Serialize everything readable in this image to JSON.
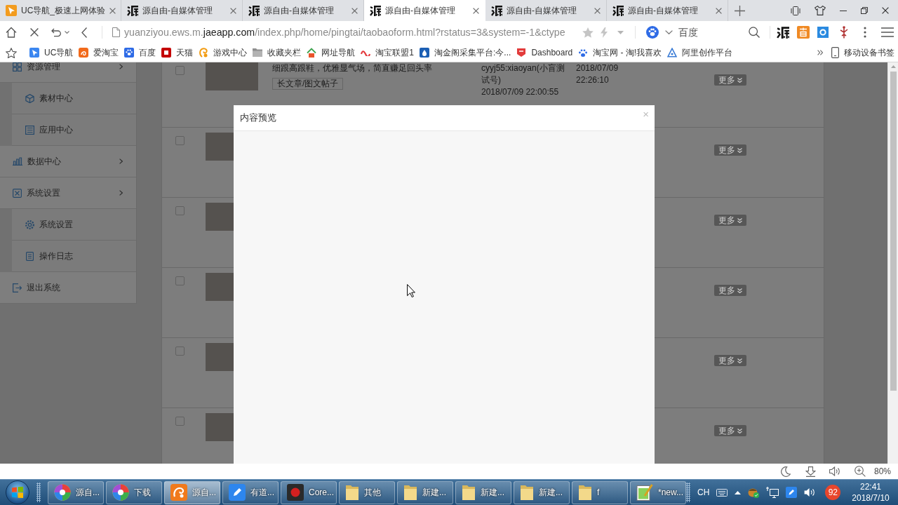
{
  "browser": {
    "tabs": [
      {
        "title": "UC导航_极速上网体验",
        "kind": "start",
        "selected": false
      },
      {
        "title": "源自由-自媒体管理",
        "kind": "site",
        "selected": false
      },
      {
        "title": "源自由-自媒体管理",
        "kind": "site",
        "selected": false
      },
      {
        "title": "源自由-自媒体管理",
        "kind": "site",
        "selected": true
      },
      {
        "title": "源自由-自媒体管理",
        "kind": "site",
        "selected": false
      },
      {
        "title": "源自由-自媒体管理",
        "kind": "site",
        "selected": false
      }
    ],
    "address_bar": {
      "url": "yuanziyou.ews.m.**jaeapp.com**/index.php/home/pingtai/taobaoform.html?rstatus=3&system=-1&ctype"
    },
    "search": {
      "placeholder": "百度"
    },
    "bookmarks": [
      {
        "label": "UC导航",
        "kind": "uc"
      },
      {
        "label": "爱淘宝",
        "kind": "taobao"
      },
      {
        "label": "百度",
        "kind": "baidu"
      },
      {
        "label": "天猫",
        "kind": "tmall"
      },
      {
        "label": "游戏中心",
        "kind": "games"
      },
      {
        "label": "收藏夹栏",
        "kind": "folder"
      },
      {
        "label": "网址导航",
        "kind": "sites"
      },
      {
        "label": "淘宝联盟1",
        "kind": "alliance"
      },
      {
        "label": "淘金阁采集平台:今...",
        "kind": "collector"
      },
      {
        "label": "Dashboard",
        "kind": "dashboard"
      },
      {
        "label": "淘宝网 - 淘!我喜欢",
        "kind": "taobaonet"
      },
      {
        "label": "阿里创作平台",
        "kind": "creator"
      }
    ],
    "mobile_bookmarks": {
      "label": "移动设备书签"
    }
  },
  "page": {
    "sidebar": {
      "items": [
        {
          "label": "资源管理",
          "kind": "resources",
          "expanded": true,
          "children": [
            {
              "label": "素材中心",
              "kind": "materials"
            },
            {
              "label": "应用中心",
              "kind": "apps"
            }
          ]
        },
        {
          "label": "数据中心",
          "kind": "data"
        },
        {
          "label": "系统设置",
          "kind": "settings",
          "expanded": true,
          "children": [
            {
              "label": "系统设置",
              "kind": "preferences"
            },
            {
              "label": "操作日志",
              "kind": "log"
            }
          ]
        },
        {
          "label": "退出系统",
          "kind": "logout"
        }
      ]
    },
    "table": {
      "rows": [
        {
          "checked": false,
          "title": "细跟高跟鞋，优雅显气场，简直赚足回头率",
          "tag": "长文章/图文帖子",
          "author": "cyyj55:xiaoyan(小盲测试号)",
          "created": "2018/07/09 22:00:55",
          "updated": "2018/07/09 22:26:10",
          "action": "更多"
        },
        {
          "checked": false,
          "action": "更多"
        },
        {
          "checked": false,
          "action": "更多"
        },
        {
          "checked": false,
          "action": "更多"
        },
        {
          "checked": false,
          "action": "更多"
        },
        {
          "checked": false,
          "action": "更多"
        }
      ]
    },
    "modal": {
      "title": "内容预览",
      "close": "×"
    }
  },
  "status_bar": {
    "zoom": "80%"
  },
  "taskbar": {
    "buttons": [
      {
        "label": "源自...",
        "kind": "browser",
        "selected": false
      },
      {
        "label": "下载",
        "kind": "browser",
        "selected": false
      },
      {
        "label": "源自...",
        "kind": "ucbrowser",
        "selected": true
      },
      {
        "label": "有道...",
        "kind": "notes",
        "selected": false
      },
      {
        "label": "Core...",
        "kind": "recorder",
        "selected": false
      },
      {
        "label": "其他",
        "kind": "folder",
        "selected": false
      },
      {
        "label": "新建...",
        "kind": "folder",
        "selected": false
      },
      {
        "label": "新建...",
        "kind": "folder",
        "selected": false
      },
      {
        "label": "新建...",
        "kind": "folder",
        "selected": false
      },
      {
        "label": "f",
        "kind": "folder",
        "selected": false
      },
      {
        "label": "*new...",
        "kind": "editor",
        "selected": false
      }
    ],
    "tray": {
      "language": "CH",
      "badge": "92",
      "time": "22:41",
      "date": "2018/7/10"
    }
  }
}
